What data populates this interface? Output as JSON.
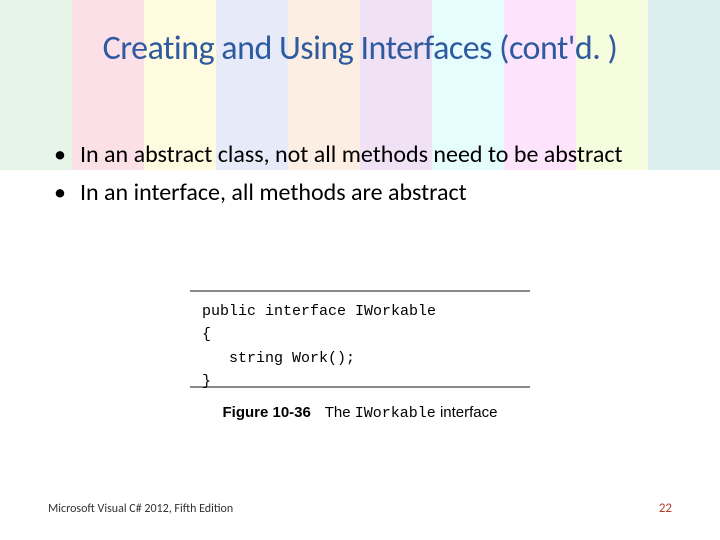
{
  "title": "Creating and Using Interfaces (cont'd. )",
  "bullets": [
    "In an abstract class, not all methods need to be abstract",
    "In an interface, all methods are abstract"
  ],
  "code": {
    "line1": "public interface IWorkable",
    "line2": "{",
    "line3": "   string Work();",
    "line4": "}"
  },
  "figure": {
    "label": "Figure 10-36",
    "text_before": "The ",
    "text_mono": "IWorkable",
    "text_after": " interface"
  },
  "footer": {
    "source": "Microsoft Visual C# 2012, Fifth Edition",
    "page": "22"
  },
  "bg_colors": [
    "#3cb44b",
    "#e6194b",
    "#ffe119",
    "#4363d8",
    "#f58231",
    "#911eb4",
    "#46f0f0",
    "#f032e6",
    "#bcf60c",
    "#008080"
  ]
}
